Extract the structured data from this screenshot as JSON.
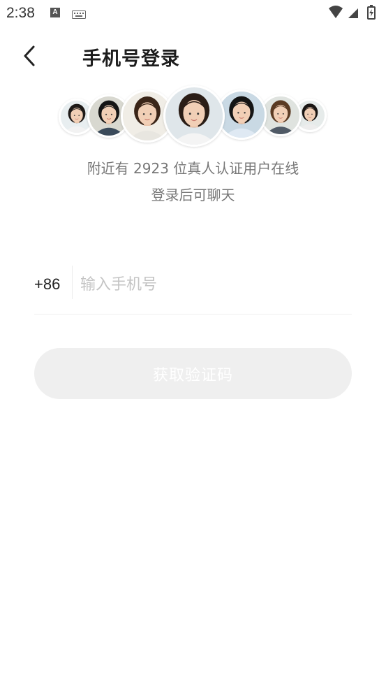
{
  "status_bar": {
    "time": "2:38",
    "notification_icons": [
      "a-icon",
      "keyboard-icon"
    ],
    "system_icons": [
      "wifi-icon",
      "signal-icon",
      "battery-icon"
    ]
  },
  "header": {
    "back_icon": "chevron-left-icon",
    "title": "手机号登录"
  },
  "avatars": [
    {
      "shirt": "#f2f2f2",
      "hair": "#1e1a18",
      "bg": "#e8eef0"
    },
    {
      "shirt": "#3a4a5a",
      "hair": "#151515",
      "bg": "#d8d8d0"
    },
    {
      "shirt": "#e8e6e0",
      "hair": "#3a2518",
      "bg": "#f0ede6"
    },
    {
      "shirt": "#f4f4f4",
      "hair": "#2a1d16",
      "bg": "#dfe6ea"
    },
    {
      "shirt": "#dfe9f3",
      "hair": "#141414",
      "bg": "#c9d9e4"
    },
    {
      "shirt": "#505a66",
      "hair": "#5b3a22",
      "bg": "#dfe3df"
    },
    {
      "shirt": "#ededed",
      "hair": "#1a1614",
      "bg": "#e6ebea"
    }
  ],
  "tagline": {
    "line1": "附近有 2923 位真人认证用户在线",
    "line2": "登录后可聊天"
  },
  "phone": {
    "country_code": "+86",
    "value": "",
    "placeholder": "输入手机号"
  },
  "get_code_button": {
    "label": "获取验证码",
    "enabled": false,
    "color": "#efefef"
  }
}
